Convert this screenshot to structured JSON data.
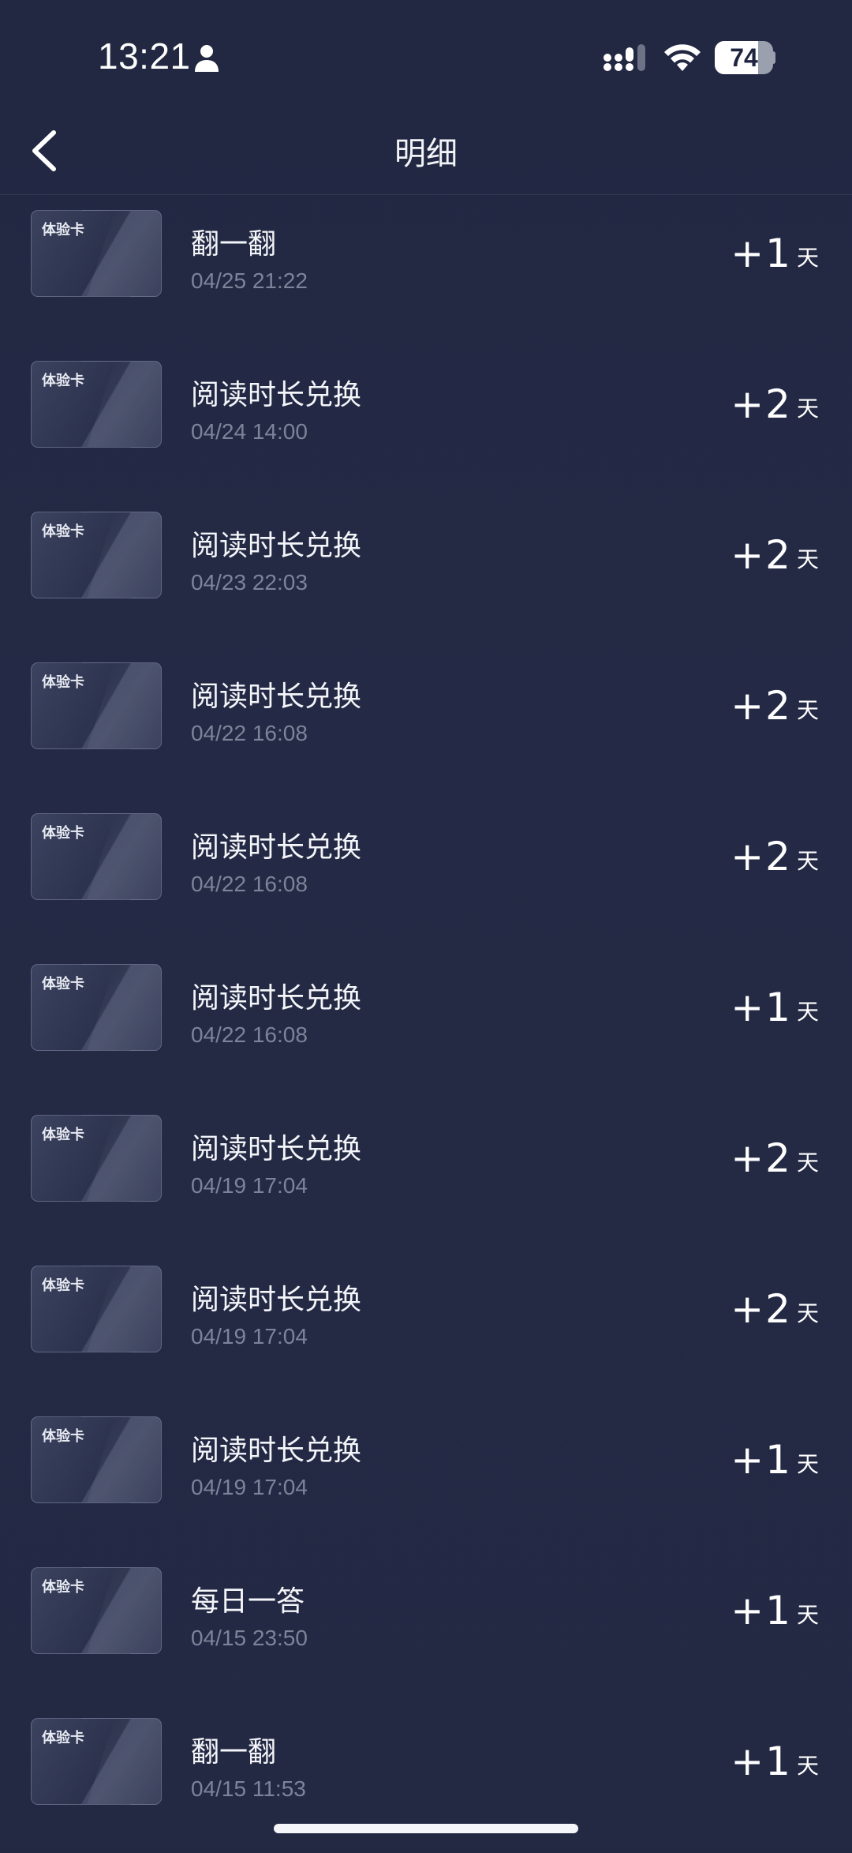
{
  "status_bar": {
    "time": "13:21",
    "battery_level": "74",
    "battery_fraction": 0.74
  },
  "nav": {
    "title": "明细",
    "back_icon": "chevron-left-icon"
  },
  "card_label": "体验卡",
  "records": [
    {
      "title": "翻一翻",
      "time": "04/25 21:22",
      "amount": "+1",
      "unit": "天"
    },
    {
      "title": "阅读时长兑换",
      "time": "04/24 14:00",
      "amount": "+2",
      "unit": "天"
    },
    {
      "title": "阅读时长兑换",
      "time": "04/23 22:03",
      "amount": "+2",
      "unit": "天"
    },
    {
      "title": "阅读时长兑换",
      "time": "04/22 16:08",
      "amount": "+2",
      "unit": "天"
    },
    {
      "title": "阅读时长兑换",
      "time": "04/22 16:08",
      "amount": "+2",
      "unit": "天"
    },
    {
      "title": "阅读时长兑换",
      "time": "04/22 16:08",
      "amount": "+1",
      "unit": "天"
    },
    {
      "title": "阅读时长兑换",
      "time": "04/19 17:04",
      "amount": "+2",
      "unit": "天"
    },
    {
      "title": "阅读时长兑换",
      "time": "04/19 17:04",
      "amount": "+2",
      "unit": "天"
    },
    {
      "title": "阅读时长兑换",
      "time": "04/19 17:04",
      "amount": "+1",
      "unit": "天"
    },
    {
      "title": "每日一答",
      "time": "04/15 23:50",
      "amount": "+1",
      "unit": "天"
    },
    {
      "title": "翻一翻",
      "time": "04/15 11:53",
      "amount": "+1",
      "unit": "天"
    }
  ]
}
